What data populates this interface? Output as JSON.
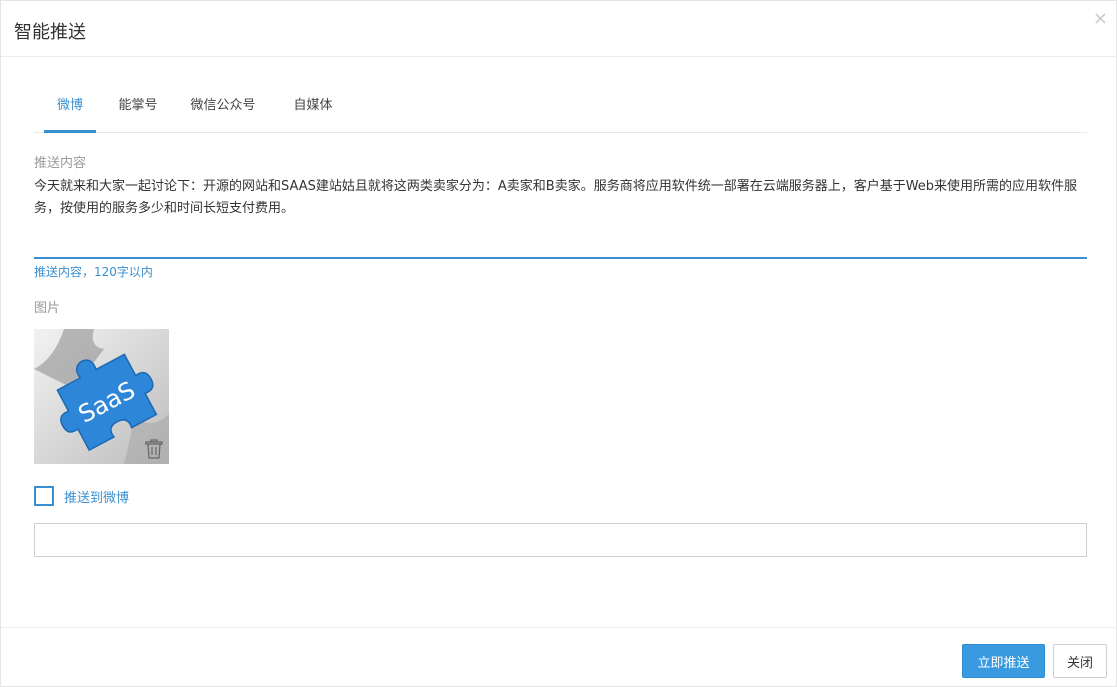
{
  "dialog": {
    "title": "智能推送",
    "close_icon": "×"
  },
  "tabs": [
    {
      "label": "微博",
      "active": true
    },
    {
      "label": "能掌号",
      "active": false
    },
    {
      "label": "微信公众号",
      "active": false
    },
    {
      "label": "自媒体",
      "active": false
    }
  ],
  "form": {
    "content_label": "推送内容",
    "content_value": "今天就来和大家一起讨论下：开源的网站和SAAS建站姑且就将这两类卖家分为：A卖家和B卖家。服务商将应用软件统一部署在云端服务器上，客户基于Web来使用所需的应用软件服务，按使用的服务多少和时间长短支付费用。",
    "content_hint": "推送内容，120字以内",
    "image_label": "图片",
    "image_text": "SaaS",
    "image_icon": "trash-icon",
    "checkbox_label": "推送到微博",
    "checkbox_checked": false,
    "extra_input_value": ""
  },
  "footer": {
    "submit_label": "立即推送",
    "close_label": "关闭"
  },
  "colors": {
    "accent": "#3a8fcf",
    "primary_button": "#3a9ae0",
    "puzzle_blue": "#2e86d8"
  }
}
